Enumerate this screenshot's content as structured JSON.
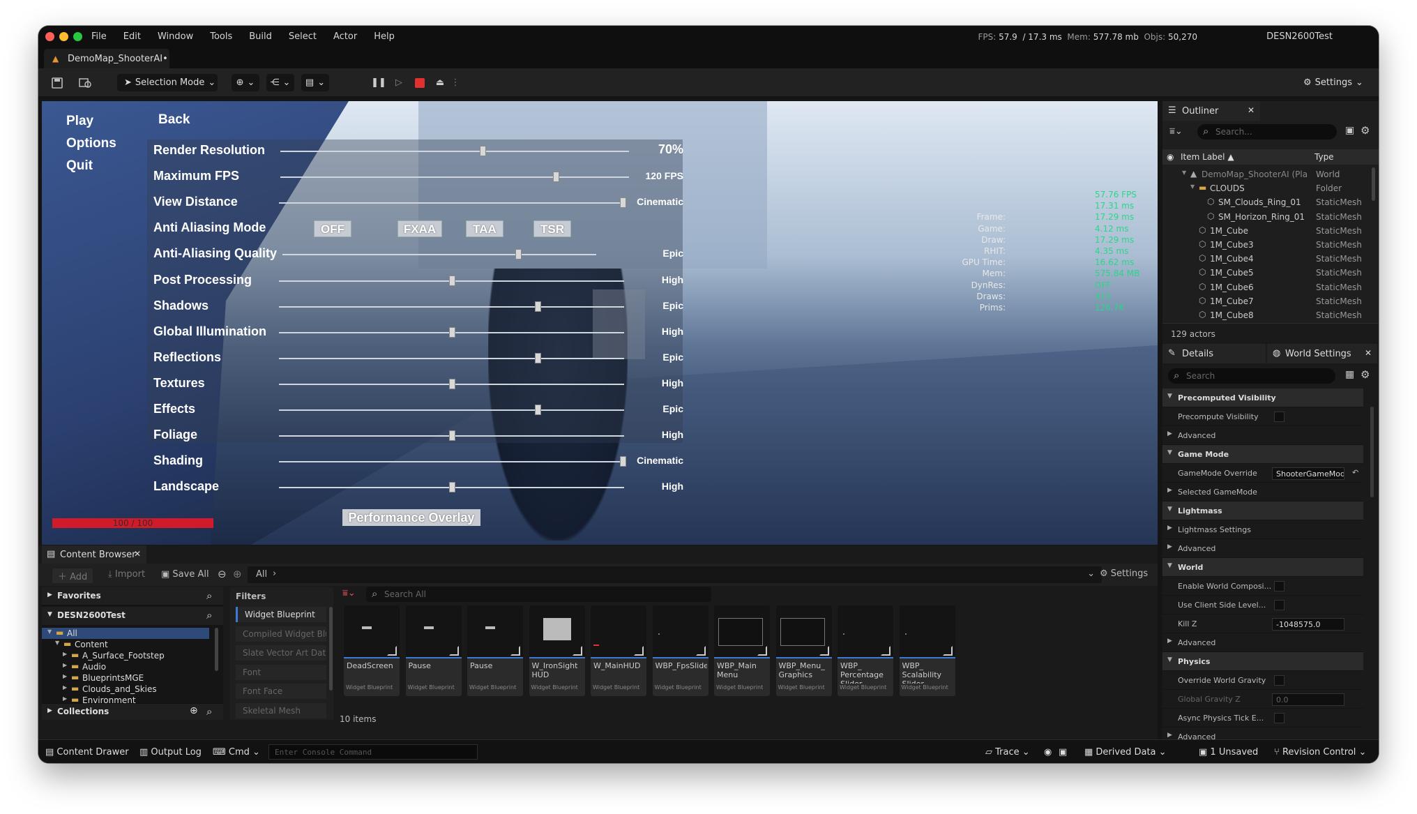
{
  "menubar": {
    "menus": [
      "File",
      "Edit",
      "Window",
      "Tools",
      "Build",
      "Select",
      "Actor",
      "Help"
    ],
    "stats": {
      "fps_label": "FPS:",
      "fps": "57.9",
      "frame": "/ 17.3 ms",
      "mem_label": "Mem:",
      "mem": "577.78 mb",
      "objs_label": "Objs:",
      "objs": "50,270"
    },
    "project": "DESN2600Test"
  },
  "tab": {
    "label": "DemoMap_ShooterAI•"
  },
  "toolbar": {
    "selection_mode": "Selection Mode",
    "settings": "Settings"
  },
  "game_menu": {
    "nav": {
      "play": "Play",
      "options": "Options",
      "quit": "Quit",
      "back": "Back"
    },
    "settings": [
      {
        "label": "Render Resolution",
        "value": "70%",
        "level": 0.58
      },
      {
        "label": "Maximum FPS",
        "value": "120 FPS",
        "level": 0.79
      },
      {
        "label": "View Distance",
        "value": "Cinematic",
        "level": 1.0
      },
      {
        "label": "Anti Aliasing Mode",
        "options": [
          "OFF",
          "FXAA",
          "TAA",
          "TSR"
        ]
      },
      {
        "label": "Anti-Aliasing Quality",
        "value": "Epic",
        "level": 0.75
      },
      {
        "label": "Post Processing",
        "value": "High",
        "level": 0.5
      },
      {
        "label": "Shadows",
        "value": "Epic",
        "level": 0.75
      },
      {
        "label": "Global Illumination",
        "value": "High",
        "level": 0.5
      },
      {
        "label": "Reflections",
        "value": "Epic",
        "level": 0.75
      },
      {
        "label": "Textures",
        "value": "High",
        "level": 0.5
      },
      {
        "label": "Effects",
        "value": "Epic",
        "level": 0.75
      },
      {
        "label": "Foliage",
        "value": "High",
        "level": 0.5
      },
      {
        "label": "Shading",
        "value": "Cinematic",
        "level": 1.0
      },
      {
        "label": "Landscape",
        "value": "High",
        "level": 0.5
      }
    ],
    "health": "100 / 100",
    "performance_overlay": "Performance Overlay"
  },
  "perf_stats": [
    {
      "k": "",
      "v": "57.76 FPS"
    },
    {
      "k": "",
      "v": "17.31 ms"
    },
    {
      "k": "Frame:",
      "v": "17.29 ms"
    },
    {
      "k": "Game:",
      "v": "4.12 ms"
    },
    {
      "k": "Draw:",
      "v": "17.29 ms"
    },
    {
      "k": "RHIT:",
      "v": "4.35 ms"
    },
    {
      "k": "GPU Time:",
      "v": "16.62 ms"
    },
    {
      "k": "Mem:",
      "v": "575.84 MB"
    },
    {
      "k": "DynRes:",
      "v": "OFF"
    },
    {
      "k": "Draws:",
      "v": "415"
    },
    {
      "k": "Prims:",
      "v": "126.7K"
    }
  ],
  "outliner": {
    "title": "Outliner",
    "search_placeholder": "Search...",
    "col_label": "Item Label ▲",
    "col_type": "Type",
    "rows": [
      {
        "name": "DemoMap_ShooterAI (Pla",
        "type": "World",
        "indent": 0
      },
      {
        "name": "CLOUDS",
        "type": "Folder",
        "indent": 1
      },
      {
        "name": "SM_Clouds_Ring_01",
        "type": "StaticMesh",
        "indent": 2
      },
      {
        "name": "SM_Horizon_Ring_01",
        "type": "StaticMesh",
        "indent": 2
      },
      {
        "name": "1M_Cube",
        "type": "StaticMesh",
        "indent": 1
      },
      {
        "name": "1M_Cube3",
        "type": "StaticMesh",
        "indent": 1
      },
      {
        "name": "1M_Cube4",
        "type": "StaticMesh",
        "indent": 1
      },
      {
        "name": "1M_Cube5",
        "type": "StaticMesh",
        "indent": 1
      },
      {
        "name": "1M_Cube6",
        "type": "StaticMesh",
        "indent": 1
      },
      {
        "name": "1M_Cube7",
        "type": "StaticMesh",
        "indent": 1
      },
      {
        "name": "1M_Cube8",
        "type": "StaticMesh",
        "indent": 1
      }
    ],
    "count": "129 actors"
  },
  "details": {
    "tab_details": "Details",
    "tab_world": "World Settings",
    "search_placeholder": "Search",
    "rows": [
      {
        "t": "Precomputed Visibility",
        "kind": "cat"
      },
      {
        "t": "Precompute Visibility",
        "kind": "chk"
      },
      {
        "t": "Advanced",
        "kind": "sub"
      },
      {
        "t": "Game Mode",
        "kind": "cat"
      },
      {
        "t": "GameMode Override",
        "kind": "field",
        "v": "ShooterGameMod"
      },
      {
        "t": "Selected GameMode",
        "kind": "sub"
      },
      {
        "t": "Lightmass",
        "kind": "cat"
      },
      {
        "t": "Lightmass Settings",
        "kind": "sub"
      },
      {
        "t": "Advanced",
        "kind": "sub"
      },
      {
        "t": "World",
        "kind": "cat"
      },
      {
        "t": "Enable World Composi...",
        "kind": "chk"
      },
      {
        "t": "Use Client Side Level...",
        "kind": "chk"
      },
      {
        "t": "Kill Z",
        "kind": "field",
        "v": "-1048575.0"
      },
      {
        "t": "Advanced",
        "kind": "sub"
      },
      {
        "t": "Physics",
        "kind": "cat"
      },
      {
        "t": "Override World Gravity",
        "kind": "chk"
      },
      {
        "t": "Global Gravity Z",
        "kind": "field",
        "v": "0.0"
      },
      {
        "t": "Async Physics Tick E...",
        "kind": "chk"
      },
      {
        "t": "Advanced",
        "kind": "sub"
      }
    ]
  },
  "content_browser": {
    "tab": "Content Browser",
    "add": "Add",
    "import": "Import",
    "save_all": "Save All",
    "path": "All",
    "settings": "Settings",
    "favorites": "Favorites",
    "project": "DESN2600Test",
    "collections": "Collections",
    "tree": [
      "All",
      "Content",
      "A_Surface_Footstep",
      "Audio",
      "BlueprintsMGE",
      "Clouds_and_Skies",
      "Environment"
    ],
    "filters_title": "Filters",
    "filters": [
      "Widget Blueprint",
      "Compiled Widget Blue",
      "Slate Vector Art Data",
      "Font",
      "Font Face",
      "Skeletal Mesh"
    ],
    "search_placeholder": "Search All",
    "assets": [
      {
        "name": "DeadScreen",
        "type": "Widget Blueprint"
      },
      {
        "name": "Pause",
        "type": "Widget Blueprint"
      },
      {
        "name": "Pause",
        "type": "Widget Blueprint"
      },
      {
        "name": "W_IronSight HUD",
        "type": "Widget Blueprint"
      },
      {
        "name": "W_MainHUD",
        "type": "Widget Blueprint"
      },
      {
        "name": "WBP_FpsSlider",
        "type": "Widget Blueprint"
      },
      {
        "name": "WBP_Main Menu",
        "type": "Widget Blueprint"
      },
      {
        "name": "WBP_Menu_ Graphics",
        "type": "Widget Blueprint"
      },
      {
        "name": "WBP_ Percentage Slider",
        "type": "Widget Blueprint"
      },
      {
        "name": "WBP_ Scalability Slider",
        "type": "Widget Blueprint"
      }
    ],
    "count": "10 items"
  },
  "statusbar": {
    "drawer": "Content Drawer",
    "output": "Output Log",
    "cmd": "Cmd",
    "console_placeholder": "Enter Console Command",
    "trace": "Trace",
    "derived": "Derived Data",
    "unsaved": "1 Unsaved",
    "revision": "Revision Control"
  }
}
